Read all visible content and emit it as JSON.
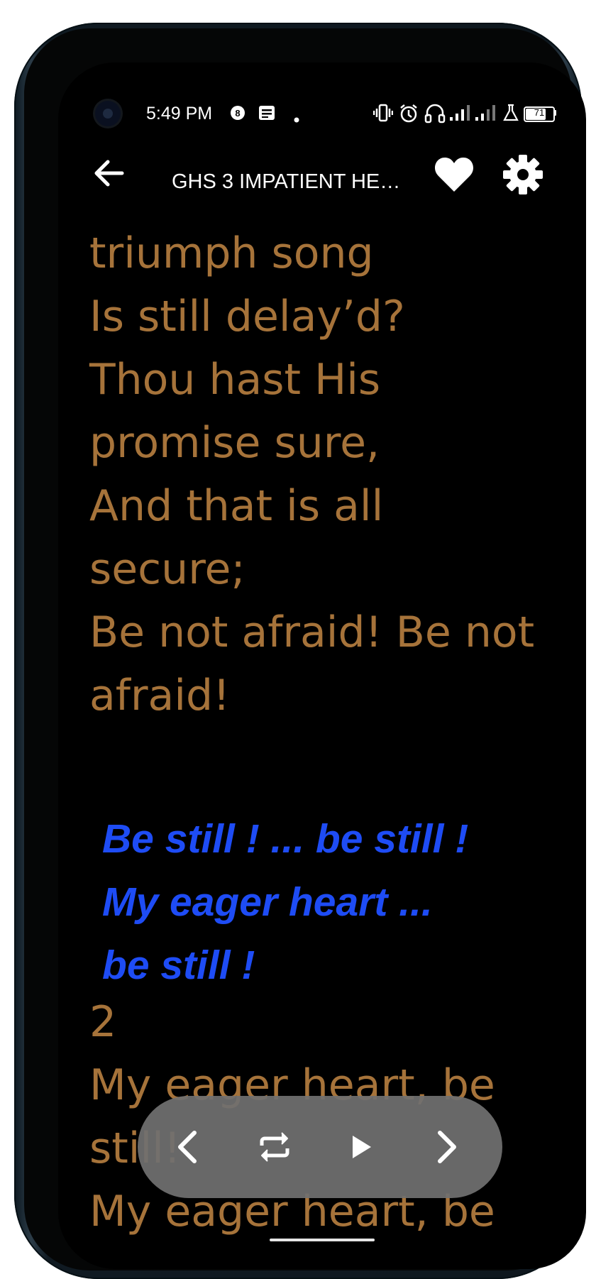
{
  "status_bar": {
    "time": "5:49 PM",
    "icons": [
      "sim-badge-icon",
      "message-icon",
      "dot-icon",
      "vibrate-icon",
      "alarm-icon",
      "headset-icon",
      "signal-icon",
      "signal-icon-2",
      "lab-icon"
    ],
    "battery_level": "71"
  },
  "app_bar": {
    "back_icon": "arrow-left-icon",
    "title": "GHS 3 IMPATIENT HE…",
    "favorite_icon": "heart-icon",
    "settings_icon": "gear-icon"
  },
  "lyrics": {
    "lines": [
      "triumph song",
      "Is still delay’d?",
      "Thou hast His",
      "promise sure,",
      "And that is all",
      "secure;",
      "Be not afraid! Be not",
      "afraid!"
    ],
    "chorus": [
      "Be still ! ... be still !",
      "My eager heart ...",
      "be still !"
    ],
    "verse_number": "2",
    "verse_lines": [
      "My eager heart, be",
      "still!",
      "My eager heart, be"
    ]
  },
  "colors": {
    "lyric_text": "#a6733a",
    "chorus_text": "#1e4cf5",
    "background": "#000000",
    "control_bar": "#707070"
  },
  "player_controls": {
    "icons": [
      "chevron-left-icon",
      "repeat-icon",
      "play-icon",
      "chevron-right-icon"
    ]
  }
}
